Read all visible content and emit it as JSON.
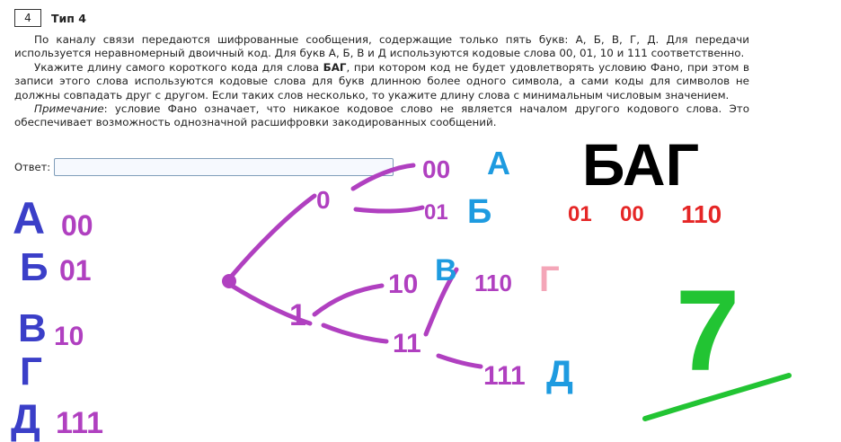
{
  "task": {
    "number": "4",
    "type": "Тип 4",
    "p1": "По каналу связи передаются шифрованные сообщения, содержащие только пять букв: А, Б, В, Г, Д. Для передачи используется неравномерный двоичный код. Для букв А, Б, В и Д используются кодовые слова 00, 01, 10 и 111 соответственно.",
    "p2_before": "Укажите длину самого короткого кода для слова ",
    "p2_bold": "БАГ",
    "p2_after": ", при котором код не будет удовлетворять условию Фано, при этом в записи этого слова используются кодовые слова для букв длинною более одного символа, а сами коды для символов не должны совпадать друг с другом. Если таких слов несколько, то укажите длину слова с минимальным числовым значением.",
    "p3_italic": "Примечание",
    "p3_rest": ": условие Фано означает, что никакое кодовое слово не является началом другого кодового слова. Это обеспечивает возможность однозначной расшифровки закодированных сообщений."
  },
  "answer": {
    "label": "Ответ:",
    "value": ""
  },
  "annotations": {
    "left_letters": [
      "А",
      "Б",
      "В",
      "Г",
      "Д"
    ],
    "left_codes": [
      "00",
      "01",
      "10",
      "",
      "111"
    ],
    "tree_root_edges": [
      "0",
      "1"
    ],
    "tree_level2": [
      "0",
      "1",
      "10",
      "11"
    ],
    "tree_leaves": [
      {
        "code": "00",
        "letter": "А"
      },
      {
        "code": "01",
        "letter": "Б"
      },
      {
        "code": "10",
        "letter": "В"
      },
      {
        "code": "110",
        "letter": "Г"
      },
      {
        "code": "111",
        "letter": "Д"
      }
    ],
    "word": "БАГ",
    "word_codes": [
      "01",
      "00",
      "110"
    ],
    "result": "7",
    "colors": {
      "purple": "#b040c0",
      "blue_letters": "#3b3fc8",
      "cyan": "#1e9be0",
      "red": "#e52626",
      "pink": "#f4a6b8",
      "green": "#22c433",
      "black": "#000000"
    }
  }
}
